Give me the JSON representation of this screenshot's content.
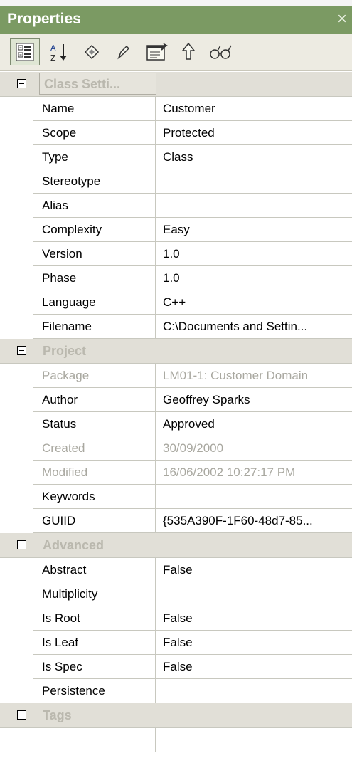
{
  "window": {
    "title": "Properties",
    "close_glyph": "×"
  },
  "toolbar": {
    "buttons": [
      {
        "icon": "categorized-icon"
      },
      {
        "icon": "sort-alphabetical-icon"
      },
      {
        "icon": "show-group-icon"
      },
      {
        "icon": "edit-icon"
      },
      {
        "icon": "properties-dialog-icon"
      },
      {
        "icon": "pin-icon"
      },
      {
        "icon": "view-icon"
      }
    ]
  },
  "groups": [
    {
      "label": "Class Setti...",
      "rows": [
        {
          "name": "Name",
          "value": "Customer",
          "readonly": false
        },
        {
          "name": "Scope",
          "value": "Protected",
          "readonly": false
        },
        {
          "name": "Type",
          "value": "Class",
          "readonly": false
        },
        {
          "name": "Stereotype",
          "value": "",
          "readonly": false
        },
        {
          "name": "Alias",
          "value": "",
          "readonly": false
        },
        {
          "name": "Complexity",
          "value": "Easy",
          "readonly": false
        },
        {
          "name": "Version",
          "value": "1.0",
          "readonly": false
        },
        {
          "name": "Phase",
          "value": "1.0",
          "readonly": false
        },
        {
          "name": "Language",
          "value": "C++",
          "readonly": false
        },
        {
          "name": "Filename",
          "value": "C:\\Documents and Settin...",
          "readonly": false
        }
      ]
    },
    {
      "label": "Project",
      "rows": [
        {
          "name": "Package",
          "value": "LM01-1: Customer Domain",
          "readonly": true
        },
        {
          "name": "Author",
          "value": "Geoffrey Sparks",
          "readonly": false
        },
        {
          "name": "Status",
          "value": "Approved",
          "readonly": false
        },
        {
          "name": "Created",
          "value": "30/09/2000",
          "readonly": true
        },
        {
          "name": "Modified",
          "value": "16/06/2002 10:27:17 PM",
          "readonly": true
        },
        {
          "name": "Keywords",
          "value": "",
          "readonly": false
        },
        {
          "name": "GUIID",
          "value": "{535A390F-1F60-48d7-85...",
          "readonly": false
        }
      ]
    },
    {
      "label": "Advanced",
      "rows": [
        {
          "name": "Abstract",
          "value": "False",
          "readonly": false
        },
        {
          "name": "Multiplicity",
          "value": "",
          "readonly": false
        },
        {
          "name": "Is Root",
          "value": "False",
          "readonly": false
        },
        {
          "name": "Is Leaf",
          "value": "False",
          "readonly": false
        },
        {
          "name": "Is Spec",
          "value": "False",
          "readonly": false
        },
        {
          "name": "Persistence",
          "value": "",
          "readonly": false
        }
      ]
    },
    {
      "label": "Tags",
      "rows": [
        {
          "name": "",
          "value": "",
          "readonly": false
        }
      ]
    }
  ]
}
